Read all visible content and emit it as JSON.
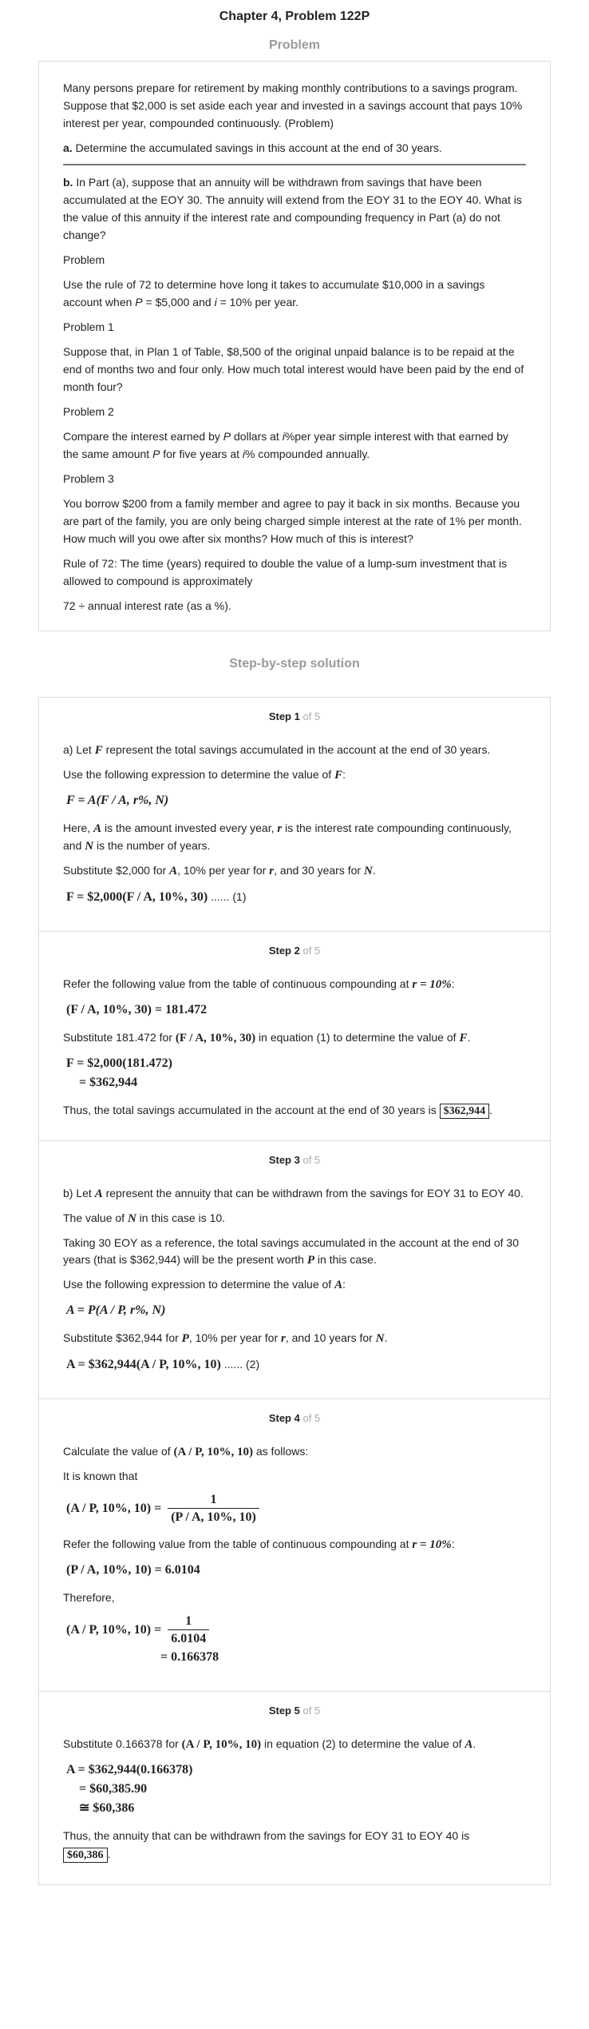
{
  "page_title": "Chapter 4, Problem 122P",
  "problem_section_title": "Problem",
  "problem": {
    "p1": "Many persons prepare for retirement by making monthly contributions to a savings program. Suppose that $2,000 is set aside each year and invested in a savings account that pays 10% interest per year, compounded continuously. (Problem)",
    "a_label": "a.",
    "a_text": " Determine the accumulated savings in this account at the end of 30 years.",
    "b_label": "b.",
    "b_text": " In Part (a), suppose that an annuity will be withdrawn from savings that have been accumulated at the EOY 30. The annuity will extend from the EOY 31 to the EOY 40. What is the value of this annuity if the interest rate and compounding frequency in Part (a) do not change?",
    "h0": "Problem",
    "p_rule_a": "Use the rule of 72 to determine hove long it takes to accumulate $10,000 in a savings account when ",
    "p_rule_P": "P",
    "p_rule_b": " = $5,000 and ",
    "p_rule_i": "i",
    "p_rule_c": " = 10% per year.",
    "h1": "Problem 1",
    "p_plan": "Suppose that, in Plan 1 of Table, $8,500 of the original unpaid balance is to be repaid at the end of months two and four only. How much total interest would have been paid by the end of month four?",
    "h2": "Problem 2",
    "p_cmp_a": "Compare the interest earned by ",
    "p_cmp_P": "P",
    "p_cmp_b": " dollars at ",
    "p_cmp_i": "i",
    "p_cmp_c": "%per year simple interest with that earned by the same amount ",
    "p_cmp_P2": "P",
    "p_cmp_d": " for five years at ",
    "p_cmp_i2": "i",
    "p_cmp_e": "% compounded annually.",
    "h3": "Problem 3",
    "p_borrow": "You borrow $200 from a family member and agree to pay it back in six months. Because you are part of the family, you are only being charged simple interest at the rate of 1% per month. How much will you owe after six months? How much of this is interest?",
    "p_rule72": "Rule of 72: The time (years) required to double the value of a lump-sum investment that is allowed to compound is approximately",
    "p_formula": "72 ÷ annual interest rate (as a %)."
  },
  "solution_section_title": "Step-by-step solution",
  "step_of": "of 5",
  "steps": {
    "s1": {
      "label": "Step 1",
      "t1a": "a) Let ",
      "t1var": "F",
      "t1b": " represent the total savings accumulated in the account at the end of 30 years.",
      "t2a": "Use the following expression to determine the value of ",
      "t2var": "F",
      "t2b": ":",
      "eq1": "F = A(F / A, r%, N)",
      "t3a": "Here, ",
      "t3A": "A",
      "t3b": " is the amount invested every year, ",
      "t3r": "r",
      "t3c": " is the interest rate compounding continuously, and ",
      "t3N": "N",
      "t3d": " is the number of years.",
      "t4a": "Substitute $2,000 for ",
      "t4A": "A",
      "t4b": ", 10% per year for ",
      "t4r": "r",
      "t4c": ", and 30 years for ",
      "t4N": "N",
      "t4d": ".",
      "eq2": "F = $2,000(F / A, 10%, 30)",
      "eq2tail": " ...... (1)"
    },
    "s2": {
      "label": "Step 2",
      "t1a": "Refer the following value from the table of continuous compounding at ",
      "t1r": "r = 10%",
      "t1b": ":",
      "eq1": "(F / A, 10%, 30) = 181.472",
      "t2a": "Substitute 181.472 for ",
      "t2expr": "(F / A, 10%, 30)",
      "t2b": " in equation (1) to determine the value of ",
      "t2F": "F",
      "t2c": ".",
      "eq2r1": "F = $2,000(181.472)",
      "eq2r2": "= $362,944",
      "t3a": "Thus, the total savings accumulated in the account at the end of 30 years is ",
      "t3box": "$362,944",
      "t3b": "."
    },
    "s3": {
      "label": "Step 3",
      "t1a": "b) Let ",
      "t1A": "A",
      "t1b": " represent the annuity that can be withdrawn from the savings for EOY 31 to EOY 40.",
      "t2a": "The value of ",
      "t2N": "N",
      "t2b": " in this case is 10.",
      "t3a": "Taking 30 EOY as a reference, the total savings accumulated in the account at the end of 30 years (that is $362,944) will be the present worth ",
      "t3P": "P",
      "t3b": " in this case.",
      "t4a": "Use the following expression to determine the value of ",
      "t4A": "A",
      "t4b": ":",
      "eq1": "A = P(A / P, r%, N)",
      "t5a": "Substitute $362,944 for ",
      "t5P": "P",
      "t5b": ", 10% per year for ",
      "t5r": "r",
      "t5c": ", and 10 years for ",
      "t5N": "N",
      "t5d": ".",
      "eq2": "A = $362,944(A / P, 10%, 10)",
      "eq2tail": " ...... (2)"
    },
    "s4": {
      "label": "Step 4",
      "t1a": "Calculate the value of ",
      "t1expr": "(A / P, 10%, 10)",
      "t1b": " as follows:",
      "t2": "It is known that",
      "eq1lhs": "(A / P, 10%, 10) =",
      "eq1num": "1",
      "eq1den": "(P / A, 10%, 10)",
      "t3a": "Refer the following value from the table of continuous compounding at ",
      "t3r": "r = 10%",
      "t3b": ":",
      "eq2": "(P / A, 10%, 10) = 6.0104",
      "t4": "Therefore,",
      "eq3lhs": "(A / P, 10%, 10) =",
      "eq3num": "1",
      "eq3den": "6.0104",
      "eq3r2": "= 0.166378"
    },
    "s5": {
      "label": "Step 5",
      "t1a": "Substitute 0.166378 for ",
      "t1expr": "(A / P, 10%, 10)",
      "t1b": " in equation (2) to determine the value of ",
      "t1A": "A",
      "t1c": ".",
      "eqr1": "A = $362,944(0.166378)",
      "eqr2": "= $60,385.90",
      "eqr3": "≅ $60,386",
      "t2": "Thus, the annuity that can be withdrawn from the savings for EOY 31 to EOY 40 is",
      "t2box": "$60,386",
      "t2tail": "."
    }
  }
}
